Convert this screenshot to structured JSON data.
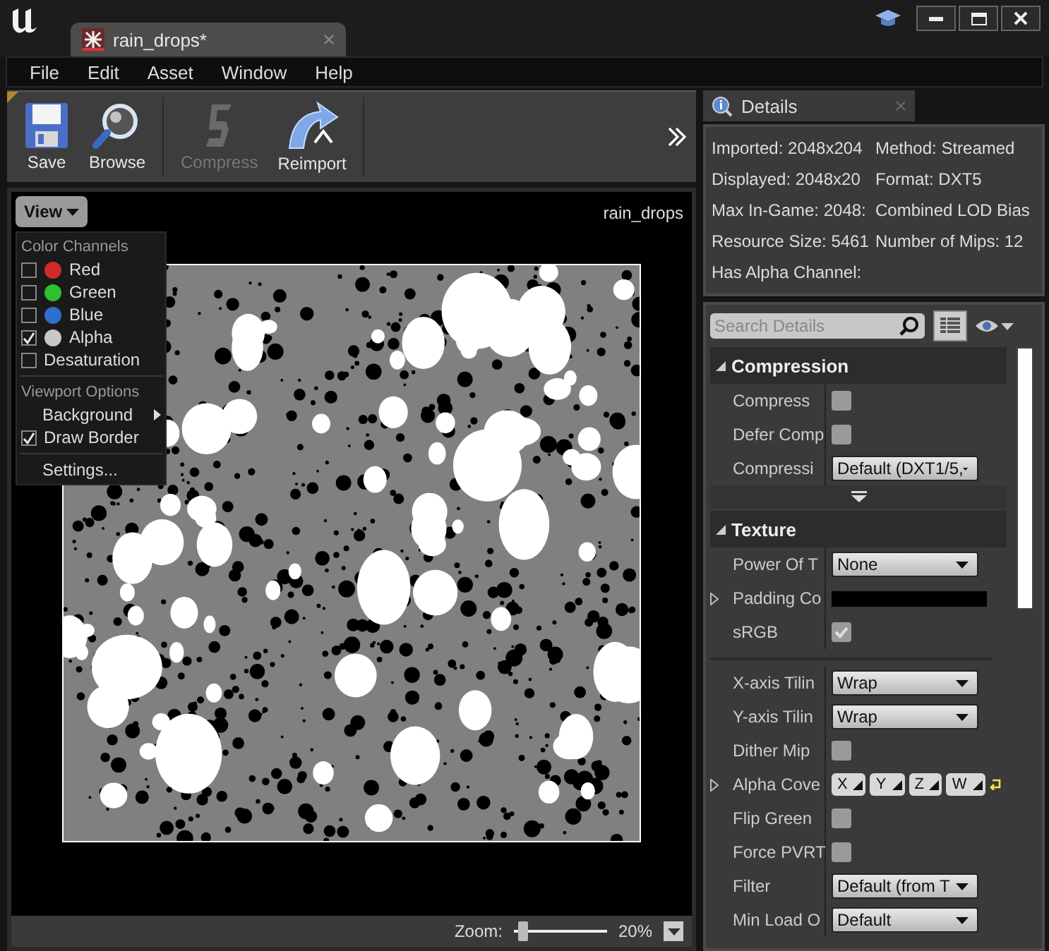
{
  "window": {
    "tab": {
      "label": "rain_drops*",
      "selected": true
    }
  },
  "menu_bar": [
    "File",
    "Edit",
    "Asset",
    "Window",
    "Help"
  ],
  "toolbar": [
    {
      "kind": "save",
      "label": "Save",
      "disabled": false
    },
    {
      "kind": "browse",
      "label": "Browse",
      "disabled": false
    },
    {
      "kind": "compress",
      "label": "Compress",
      "disabled": true
    },
    {
      "kind": "reimport",
      "label": "Reimport",
      "disabled": false
    }
  ],
  "viewport": {
    "asset_name": "rain_drops",
    "view_button": "View",
    "view_menu": [
      {
        "heading": "Color Channels",
        "items": [
          {
            "kind": "channel",
            "label": "Red",
            "checked": false,
            "color": "#d02a2a"
          },
          {
            "kind": "channel",
            "label": "Green",
            "checked": false,
            "color": "#2fbf2f"
          },
          {
            "kind": "channel",
            "label": "Blue",
            "checked": false,
            "color": "#2f6fd0"
          },
          {
            "kind": "channel",
            "label": "Alpha",
            "checked": true,
            "color": "#c8c8c8"
          },
          {
            "kind": "check",
            "label": "Desaturation",
            "checked": false
          }
        ]
      },
      {
        "heading": "Viewport Options",
        "items": [
          {
            "kind": "submenu",
            "label": "Background"
          },
          {
            "kind": "check",
            "label": "Draw Border",
            "checked": true
          }
        ]
      },
      {
        "items": [
          {
            "kind": "action",
            "label": "Settings..."
          }
        ]
      }
    ],
    "zoom": {
      "label": "Zoom:",
      "level": 0.05,
      "reading": "20%"
    }
  },
  "details": {
    "tab": "Details",
    "info": [
      "Imported: 2048x204",
      "Method: Streamed",
      "Displayed: 2048x20",
      "Format: DXT5",
      "Max In-Game: 2048:",
      "Combined LOD Bias",
      "Resource Size: 5461",
      "Number of Mips: 12",
      "Has Alpha Channel:"
    ],
    "search": {
      "placeholder": "Search Details"
    },
    "categories": [
      {
        "title": "Compression",
        "expanded": true,
        "rows": [
          {
            "kind": "checkbox",
            "label": "Compress",
            "checked": false
          },
          {
            "kind": "checkbox",
            "label": "Defer Comp",
            "checked": false
          },
          {
            "kind": "dropdown",
            "label": "Compressi",
            "value": "Default (DXT1/5,"
          }
        ]
      },
      {
        "title": "Texture",
        "expanded": true,
        "rows": [
          {
            "kind": "dropdown",
            "label": "Power Of T",
            "value": "None"
          },
          {
            "kind": "swatch",
            "label": "Padding Co",
            "expandable": true
          },
          {
            "kind": "checkbox",
            "label": "sRGB",
            "checked": true
          }
        ],
        "more_rows": [
          {
            "kind": "dropdown",
            "label": "X-axis Tilin",
            "value": "Wrap"
          },
          {
            "kind": "dropdown",
            "label": "Y-axis Tilin",
            "value": "Wrap"
          },
          {
            "kind": "checkbox",
            "label": "Dither Mip",
            "checked": false
          },
          {
            "kind": "vector",
            "label": "Alpha Cove",
            "expandable": true,
            "components": [
              "X",
              "Y",
              "Z",
              "W"
            ]
          },
          {
            "kind": "checkbox",
            "label": "Flip Green",
            "checked": false
          },
          {
            "kind": "checkbox",
            "label": "Force PVRT",
            "checked": false
          },
          {
            "kind": "dropdown",
            "label": "Filter",
            "value": "Default (from T"
          },
          {
            "kind": "dropdown",
            "label": "Min Load O",
            "value": "Default"
          }
        ]
      }
    ]
  }
}
